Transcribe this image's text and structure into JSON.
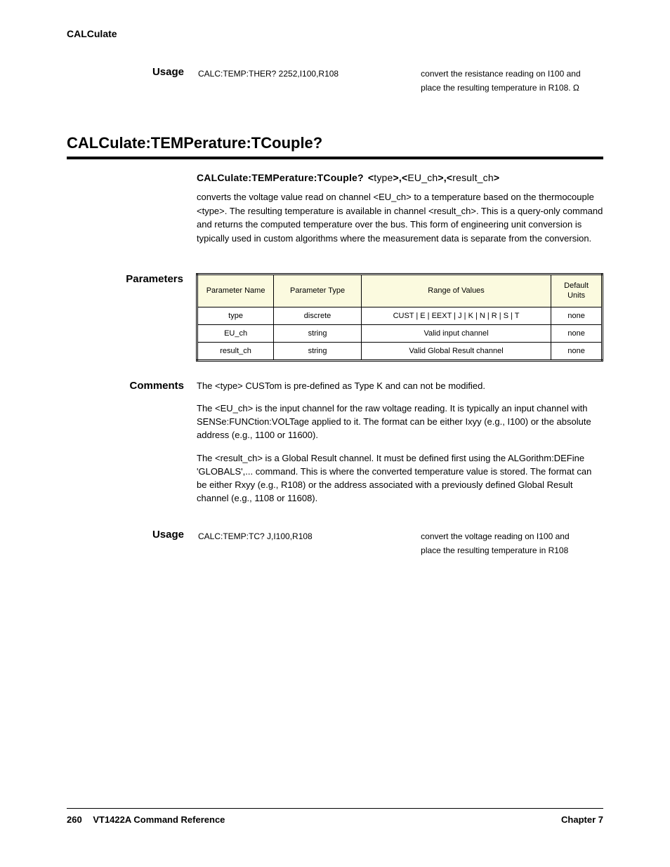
{
  "header": {
    "tag": "CALCulate"
  },
  "topUsage": {
    "label": "Usage",
    "line1_left": "CALC:TEMP:THER? 2252,I100,R108",
    "line1_right": "convert the resistance reading on I100 and",
    "line2_right": "place the resulting temperature in R108. Ω"
  },
  "heading": "CALCulate:TEMPerature:TCouple?",
  "syntax": {
    "bold": "CALCulate:TEMPerature:TCouple? <",
    "p1": "type",
    "sep1": ">,<",
    "p2": "EU_ch",
    "sep2": ">,<",
    "p3": "result_ch",
    "end": ">"
  },
  "description": "converts the voltage value read on channel <EU_ch> to a temperature based on the thermocouple <type>. The resulting temperature is available in channel <result_ch>. This is a query-only command and returns the computed temperature over the bus. This form of engineering unit conversion is typically used in custom algorithms where the measurement data is separate from the conversion.",
  "parametersLabel": "Parameters",
  "paramTable": {
    "headers": [
      "Parameter Name",
      "Parameter Type",
      "Range of Values",
      "Default Units"
    ],
    "rows": [
      [
        "type",
        "discrete",
        "CUST | E | EEXT | J | K | N | R | S | T",
        "none"
      ],
      [
        "EU_ch",
        "string",
        "Valid input channel",
        "none"
      ],
      [
        "result_ch",
        "string",
        "Valid Global Result channel",
        "none"
      ]
    ]
  },
  "commentsLabel": "Comments",
  "comments": [
    "The <type> CUSTom is pre-defined as Type K and can not be modified.",
    "The <EU_ch> is the input channel for the raw voltage reading. It is typically an input channel with SENSe:FUNCtion:VOLTage applied to it. The format can be either Ixyy (e.g., I100) or the absolute address (e.g., 1100 or 11600).",
    "The <result_ch> is a Global Result channel. It must be defined first using the ALGorithm:DEFine 'GLOBALS',... command. This is where the converted temperature value is stored. The format can be either Rxyy (e.g., R108) or the address associated with a previously defined Global Result channel (e.g., 1108 or 11608)."
  ],
  "bottomUsage": {
    "label": "Usage",
    "line1_left": "CALC:TEMP:TC? J,I100,R108",
    "line1_right": "convert the voltage reading on I100 and",
    "line2_right": "place the resulting temperature in R108"
  },
  "footer": {
    "page": "260",
    "title": "VT1422A Command Reference",
    "chapter": "Chapter 7"
  }
}
